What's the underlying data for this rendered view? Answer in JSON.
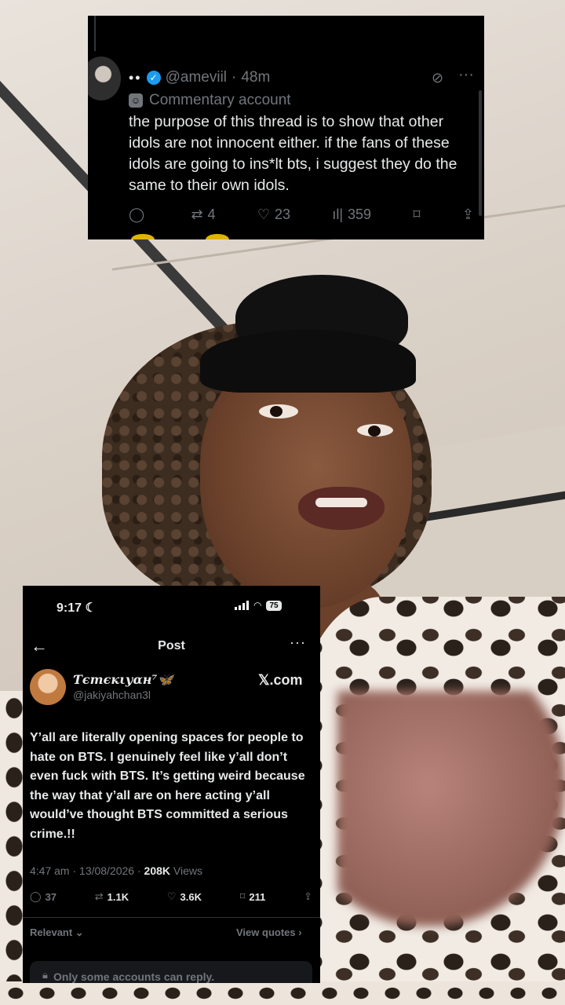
{
  "top_post": {
    "handle_dots": "••",
    "handle": "@ameviil",
    "separator": "·",
    "time": "48m",
    "label": "Commentary account",
    "text": "the purpose of this thread is to show that other idols are not innocent either. if the fans of these idols are going to ins*lt bts, i suggest they do the same to their own idols.",
    "replies": "",
    "reposts": "4",
    "likes": "23",
    "views": "359"
  },
  "phone": {
    "status_time": "9:17",
    "battery": "75",
    "nav_title": "Post",
    "author_name": "Ƭєтєкιуαн⁷🦋",
    "author_handle": "@jakiyahchan3l",
    "source": "𝕏.com",
    "text": "Y’all are literally opening spaces for people to hate on BTS. I genuinely feel like y’all don’t even fuck with BTS. It’s getting weird because the way that y’all are on here acting y’all would’ve thought BTS committed a serious crime.!!",
    "timestamp": "4:47 am · 13/08/2026 · ",
    "views_count": "208K",
    "views_label": " Views",
    "replies": "37",
    "reposts": "1.1K",
    "likes": "3.6K",
    "bookmarks": "211",
    "sort_label": "Relevant ⌄",
    "quotes_label": "View quotes ›",
    "reply_notice": "Only some accounts can reply."
  }
}
